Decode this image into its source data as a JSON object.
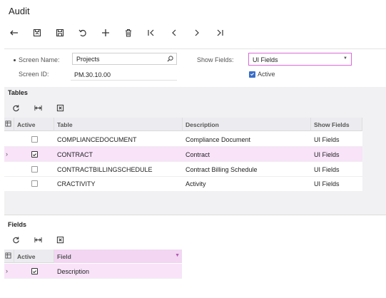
{
  "page": {
    "title": "Audit"
  },
  "toolbar": {
    "buttons": [
      {
        "name": "undo-back-button",
        "icon": "back-arrow-icon"
      },
      {
        "name": "save-and-close-button",
        "icon": "save-close-icon"
      },
      {
        "name": "save-button",
        "icon": "save-icon"
      },
      {
        "name": "cancel-button",
        "icon": "undo-icon"
      },
      {
        "name": "add-button",
        "icon": "plus-icon"
      },
      {
        "name": "delete-button",
        "icon": "trash-icon"
      },
      {
        "name": "first-record-button",
        "icon": "first-icon"
      },
      {
        "name": "previous-record-button",
        "icon": "prev-icon"
      },
      {
        "name": "next-record-button",
        "icon": "next-icon"
      },
      {
        "name": "last-record-button",
        "icon": "last-icon"
      }
    ]
  },
  "form": {
    "screen_name_label": "Screen Name:",
    "screen_name_value": "Projects",
    "screen_id_label": "Screen ID:",
    "screen_id_value": "PM.30.10.00",
    "show_fields_label": "Show Fields:",
    "show_fields_value": "UI Fields",
    "active_label": "Active",
    "active_checked": true
  },
  "tables_section": {
    "title": "Tables",
    "columns": {
      "active": "Active",
      "table": "Table",
      "description": "Description",
      "show_fields": "Show Fields"
    },
    "rows": [
      {
        "active": false,
        "table": "COMPLIANCEDOCUMENT",
        "description": "Compliance Document",
        "show_fields": "UI Fields",
        "selected": false
      },
      {
        "active": true,
        "table": "CONTRACT",
        "description": "Contract",
        "show_fields": "UI Fields",
        "selected": true
      },
      {
        "active": false,
        "table": "CONTRACTBILLINGSCHEDULE",
        "description": "Contract Billing Schedule",
        "show_fields": "UI Fields",
        "selected": false
      },
      {
        "active": false,
        "table": "CRACTIVITY",
        "description": "Activity",
        "show_fields": "UI Fields",
        "selected": false
      }
    ]
  },
  "fields_section": {
    "title": "Fields",
    "columns": {
      "active": "Active",
      "field": "Field"
    },
    "rows": [
      {
        "active": true,
        "field": "Description",
        "selected": true
      }
    ]
  },
  "colors": {
    "accent": "#d96ad9",
    "selected_row": "#f9e3f9",
    "checkbox_blue": "#3a6ec9"
  }
}
